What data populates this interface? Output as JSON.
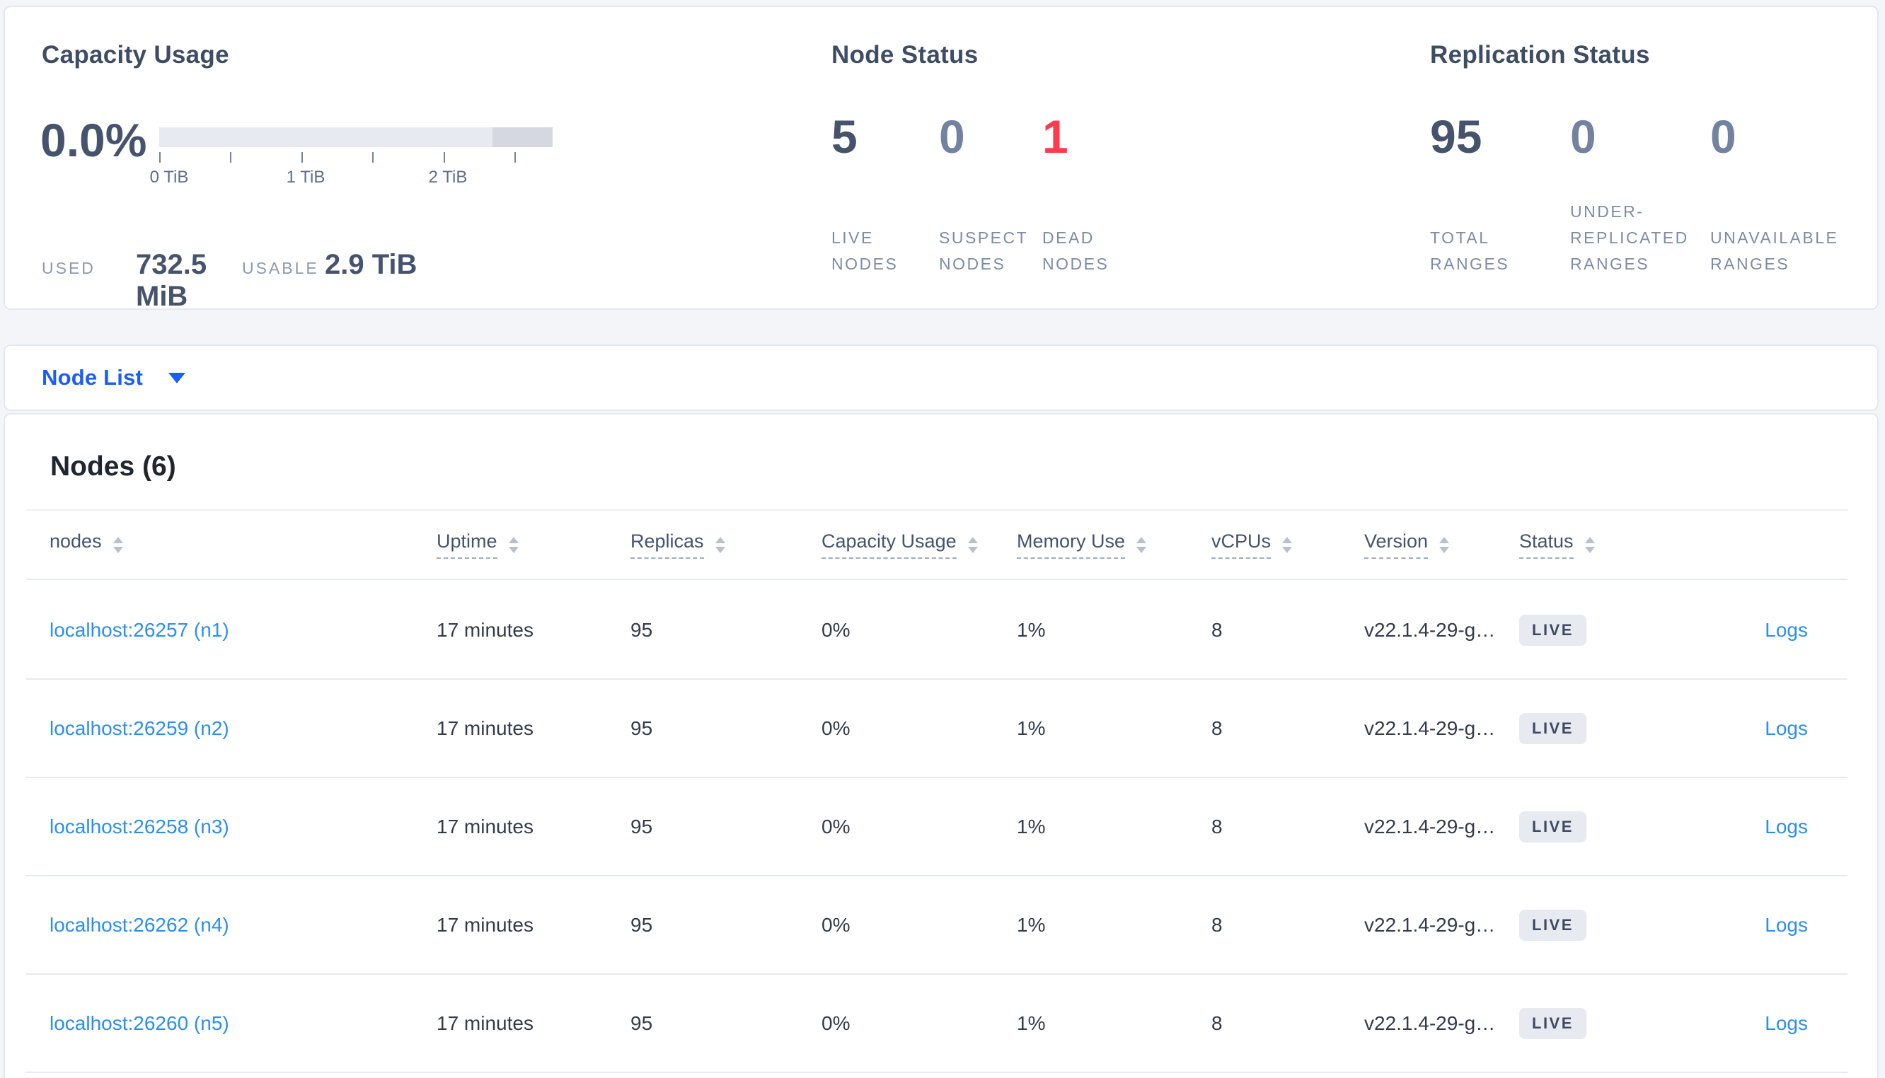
{
  "colors": {
    "page_background": "#f3f5f9",
    "card_background": "#ffffff",
    "dark_slate_number": "#46536d",
    "muted_slate_number": "#7382a1",
    "dead_nodes_red": "#ff3b4b",
    "stat_label": "#7e8ba6",
    "node_link_blue": "#2a8ef2",
    "dropdown_blue": "#1c5ef5",
    "capacity_bar_light": "#e8eaf1",
    "capacity_bar_dark": "#d5d8e1",
    "badge_background": "#e7eaf0"
  },
  "panels": {
    "capacity": {
      "title": "Capacity Usage",
      "percent": "0.0%",
      "tick_labels": [
        "0 TiB",
        "1 TiB",
        "2 TiB"
      ],
      "used_label": "USED",
      "used_value": "732.5 MiB",
      "usable_label": "USABLE",
      "usable_value": "2.9 TiB"
    },
    "node_status": {
      "title": "Node Status",
      "stats": [
        {
          "value": "5",
          "label": "LIVE NODES"
        },
        {
          "value": "0",
          "label": "SUSPECT NODES"
        },
        {
          "value": "1",
          "label": "DEAD NODES"
        }
      ]
    },
    "replication": {
      "title": "Replication Status",
      "stats": [
        {
          "value": "95",
          "label": "TOTAL RANGES"
        },
        {
          "value": "0",
          "label": "UNDER-REPLICATED RANGES"
        },
        {
          "value": "0",
          "label": "UNAVAILABLE RANGES"
        }
      ]
    }
  },
  "node_list_bar": {
    "label": "Node List"
  },
  "nodes_section": {
    "heading": "Nodes (6)",
    "columns": [
      {
        "label": "nodes"
      },
      {
        "label": "Uptime"
      },
      {
        "label": "Replicas"
      },
      {
        "label": "Capacity Usage"
      },
      {
        "label": "Memory Use"
      },
      {
        "label": "vCPUs"
      },
      {
        "label": "Version"
      },
      {
        "label": "Status"
      }
    ],
    "logs_label": "Logs",
    "rows": [
      {
        "node": "localhost:26257 (n1)",
        "uptime": "17 minutes",
        "replicas": "95",
        "capacity_usage": "0%",
        "memory_use": "1%",
        "vcpus": "8",
        "version": "v22.1.4-29-g…",
        "status": "LIVE"
      },
      {
        "node": "localhost:26259 (n2)",
        "uptime": "17 minutes",
        "replicas": "95",
        "capacity_usage": "0%",
        "memory_use": "1%",
        "vcpus": "8",
        "version": "v22.1.4-29-g…",
        "status": "LIVE"
      },
      {
        "node": "localhost:26258 (n3)",
        "uptime": "17 minutes",
        "replicas": "95",
        "capacity_usage": "0%",
        "memory_use": "1%",
        "vcpus": "8",
        "version": "v22.1.4-29-g…",
        "status": "LIVE"
      },
      {
        "node": "localhost:26262 (n4)",
        "uptime": "17 minutes",
        "replicas": "95",
        "capacity_usage": "0%",
        "memory_use": "1%",
        "vcpus": "8",
        "version": "v22.1.4-29-g…",
        "status": "LIVE"
      },
      {
        "node": "localhost:26260 (n5)",
        "uptime": "17 minutes",
        "replicas": "95",
        "capacity_usage": "0%",
        "memory_use": "1%",
        "vcpus": "8",
        "version": "v22.1.4-29-g…",
        "status": "LIVE"
      }
    ]
  }
}
